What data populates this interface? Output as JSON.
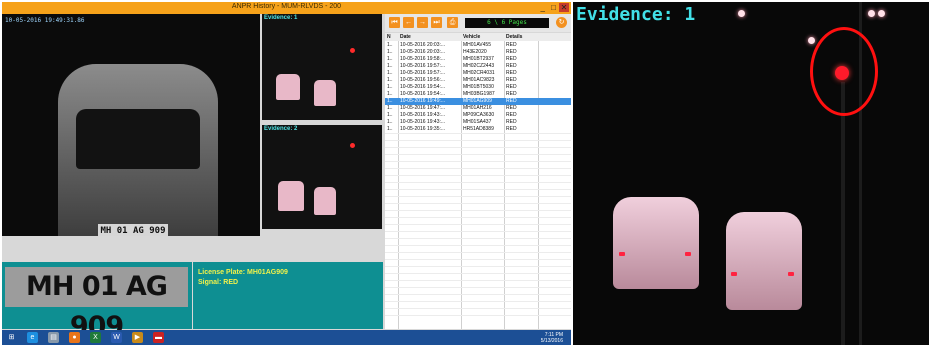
{
  "window": {
    "title": "ANPR History - MUM-RLVDS - 200",
    "controls": {
      "min": "_",
      "max": "□",
      "close": "✕"
    }
  },
  "main_camera": {
    "timestamp": "10-05-2016 19:49:31.86",
    "plate_text": "MH 01 AG 909"
  },
  "evidence_thumbs": [
    {
      "label": "Evidence: 1"
    },
    {
      "label": "Evidence: 2"
    }
  ],
  "toolbar": {
    "buttons": [
      {
        "icon": "first-page-icon",
        "glyph": "⏮"
      },
      {
        "icon": "prev-page-icon",
        "glyph": "←"
      },
      {
        "icon": "next-page-icon",
        "glyph": "→"
      },
      {
        "icon": "last-page-icon",
        "glyph": "⏭"
      },
      {
        "icon": "print-icon",
        "glyph": "⎙"
      }
    ],
    "pages": "6 \\ 6 Pages",
    "refresh_glyph": "↻"
  },
  "table": {
    "headers": [
      "N",
      "Date",
      "Vehicle",
      "Details"
    ],
    "rows": [
      [
        "1..",
        "10-05-2016 20:03:...",
        "MH01AV455",
        "RED"
      ],
      [
        "1..",
        "10-05-2016 20:03:...",
        "H43E2020",
        "RED"
      ],
      [
        "1..",
        "10-05-2016 19:58:...",
        "MH01BT2937",
        "RED"
      ],
      [
        "1..",
        "10-05-2016 19:57:...",
        "MH02CZ2443",
        "RED"
      ],
      [
        "1..",
        "10-05-2016 19:57:...",
        "MH02CR4031",
        "RED"
      ],
      [
        "1..",
        "10-05-2016 19:56:...",
        "MH01AC9823",
        "RED"
      ],
      [
        "1..",
        "10-05-2016 19:54:...",
        "MH01BT5030",
        "RED"
      ],
      [
        "1..",
        "10-05-2016 19:54:...",
        "MH03BG1987",
        "RED"
      ],
      [
        "1..",
        "10-05-2016 19:49:...",
        "MH01AG909",
        "RED"
      ],
      [
        "1..",
        "10-05-2016 19:47:...",
        "MH01AH216",
        "RED"
      ],
      [
        "1..",
        "10-05-2016 19:43:...",
        "MP09CA3630",
        "RED"
      ],
      [
        "1..",
        "10-05-2016 19:43:...",
        "MH01SA437",
        "RED"
      ],
      [
        "1..",
        "10-05-2016 19:35:...",
        "HR51AD8389",
        "RED"
      ]
    ],
    "selected_index": 8
  },
  "plate_panel": {
    "plate_image_text": "MH 01 AG 909",
    "license_plate": "License Plate: MH01AG909",
    "signal": "Signal: RED"
  },
  "taskbar": {
    "apps": [
      {
        "icon": "windows-start-icon",
        "glyph": "⊞",
        "color": "#1c4f95"
      },
      {
        "icon": "ie-icon",
        "glyph": "e",
        "color": "#1d8fe0"
      },
      {
        "icon": "file-icon",
        "glyph": "▤",
        "color": "#8899aa"
      },
      {
        "icon": "firefox-icon",
        "glyph": "●",
        "color": "#e8741a"
      },
      {
        "icon": "excel-icon",
        "glyph": "X",
        "color": "#1f7a3a"
      },
      {
        "icon": "word-icon",
        "glyph": "W",
        "color": "#2a5ab0"
      },
      {
        "icon": "media-icon",
        "glyph": "▶",
        "color": "#c88a1a"
      },
      {
        "icon": "car-app-icon",
        "glyph": "▬",
        "color": "#c22"
      }
    ],
    "time": "7:11 PM",
    "date": "5/13/2016"
  },
  "evidence_full": {
    "label": "Evidence: 1"
  }
}
